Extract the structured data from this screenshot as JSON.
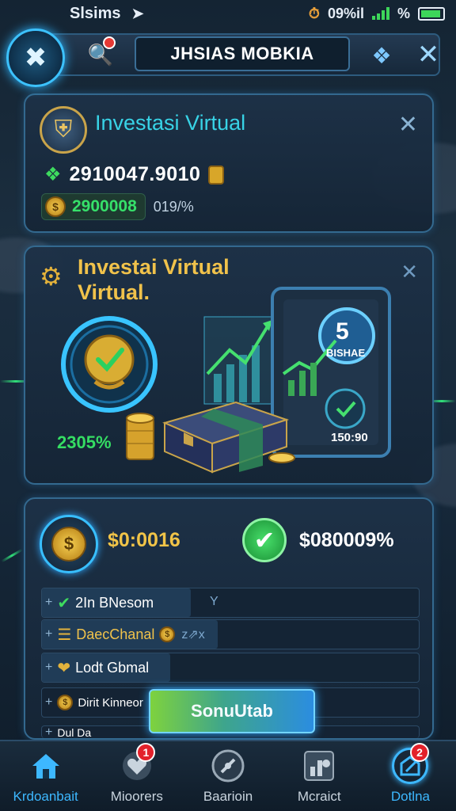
{
  "status_bar": {
    "carrier": "Slsims",
    "right_text": "09%il",
    "battery_text": "%",
    "accent": "#3dd65a"
  },
  "header": {
    "title": "JHSIAS MOBKIA",
    "logo_icon": "crossed-tools-icon",
    "search_icon": "search-icon",
    "puzzle_icon": "puzzle-icon",
    "close_icon": "close-icon"
  },
  "card_summary": {
    "title": "Investasi Virtual",
    "balance": "2910047.9010",
    "coin_value": "2900008",
    "coin_pct": "019/%",
    "shield_icon": "shield-icon",
    "close_icon": "close-icon"
  },
  "card_feature": {
    "title_line1": "Investai Virtual",
    "title_line2": "Virtual.",
    "percent": "2305%",
    "tablet_badge": "5",
    "tablet_badge_label": "BISHAE",
    "tablet_value": "150:90",
    "close_icon": "close-icon"
  },
  "card_actions": {
    "value_left": "$0:0016",
    "value_right": "$080009%",
    "rows": [
      {
        "label": "2In BNesom",
        "icon": "check-icon",
        "trail": "Y"
      },
      {
        "label": "DaecChanal",
        "icon": "stack-icon",
        "trail": "z⇗x"
      },
      {
        "label": "Lodt Gbmal",
        "icon": "heart-icon",
        "trail": ""
      },
      {
        "label": "Dirit Kinneor",
        "icon": "coin-icon",
        "trail": ""
      },
      {
        "label": "Dul Da",
        "icon": "coin-icon",
        "trail": ""
      }
    ],
    "button_label": "SonuUtab"
  },
  "bottom_nav": [
    {
      "label": "Krdoanbait",
      "icon": "home-icon",
      "badge": ""
    },
    {
      "label": "Mioorers",
      "icon": "heart-icon",
      "badge": "1"
    },
    {
      "label": "Baarioin",
      "icon": "compass-icon",
      "badge": ""
    },
    {
      "label": "Mcraict",
      "icon": "chart-icon",
      "badge": ""
    },
    {
      "label": "Dotlna",
      "icon": "edit-icon",
      "badge": "2"
    }
  ],
  "colors": {
    "accent_blue": "#3db8ff",
    "accent_gold": "#f0c24b",
    "accent_green": "#35dd63",
    "badge_red": "#e3212b"
  }
}
